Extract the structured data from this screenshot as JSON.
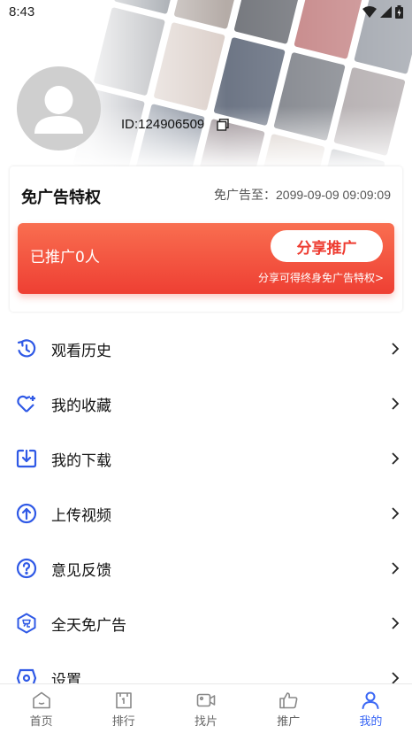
{
  "status_bar": {
    "time": "8:43"
  },
  "profile": {
    "user_id": "ID:124906509"
  },
  "vip": {
    "title": "免广告特权",
    "expire": "免广告至：2099-09-09 09:09:09",
    "promo_count": "已推广0人",
    "share_button": "分享推广",
    "share_hint": "分享可得终身免广告特权>"
  },
  "menu": {
    "items": [
      {
        "label": "观看历史",
        "icon": "history-icon"
      },
      {
        "label": "我的收藏",
        "icon": "favorite-icon"
      },
      {
        "label": "我的下载",
        "icon": "download-icon"
      },
      {
        "label": "上传视频",
        "icon": "upload-icon"
      },
      {
        "label": "意见反馈",
        "icon": "feedback-icon"
      },
      {
        "label": "全天免广告",
        "icon": "ad-free-icon"
      },
      {
        "label": "设置",
        "icon": "settings-icon"
      }
    ]
  },
  "bottom_nav": {
    "items": [
      {
        "label": "首页",
        "icon": "home-icon"
      },
      {
        "label": "排行",
        "icon": "ranking-icon"
      },
      {
        "label": "找片",
        "icon": "find-video-icon"
      },
      {
        "label": "推广",
        "icon": "promote-icon"
      },
      {
        "label": "我的",
        "icon": "profile-icon"
      }
    ],
    "active": "我的"
  },
  "colors": {
    "accent": "#3a67f5",
    "promo": "#ee3f33",
    "menu_icon": "#2f59e6"
  }
}
